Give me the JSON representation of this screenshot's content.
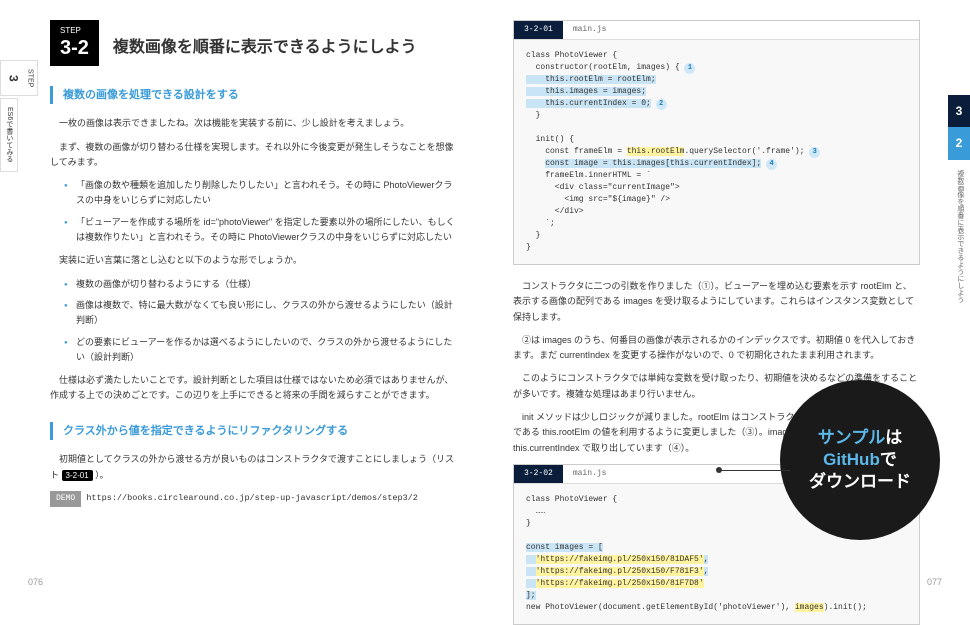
{
  "left": {
    "sidetab": {
      "step": "STEP",
      "num": "3",
      "label": "ES6で書いてみる"
    },
    "badge": {
      "step": "STEP",
      "num": "3-2"
    },
    "title": "複数画像を順番に表示できるようにしよう",
    "section1": {
      "heading": "複数の画像を処理できる設計をする",
      "p1": "一枚の画像は表示できましたね。次は機能を実装する前に、少し設計を考えましょう。",
      "p2": "まず、複数の画像が切り替わる仕様を実現します。それ以外に今後変更が発生しそうなことを想像してみます。",
      "bullets1": [
        "「画像の数や種類を追加したり削除したりしたい」と言われそう。その時に PhotoViewerクラスの中身をいじらずに対応したい",
        "「ビューアーを作成する場所を id=\"photoViewer\" を指定した要素以外の場所にしたい、もしくは複数作りたい」と言われそう。その時に PhotoViewerクラスの中身をいじらずに対応したい"
      ],
      "p3": "実装に近い言葉に落とし込むと以下のような形でしょうか。",
      "bullets2": [
        "複数の画像が切り替わるようにする（仕様）",
        "画像は複数で、特に最大数がなくても良い形にし、クラスの外から渡せるようにしたい（設計判断）",
        "どの要素にビューアーを作るかは選べるようにしたいので、クラスの外から渡せるようにしたい（設計判断）"
      ],
      "p4": "仕様は必ず満たしたいことです。設計判断とした項目は仕様ではないため必須ではありませんが、作成する上での決めごとです。この辺りを上手にできると将来の手間を減らすことができます。"
    },
    "section2": {
      "heading": "クラス外から値を指定できるようにリファクタリングする",
      "p1_a": "初期値としてクラスの外から渡せる方が良いものはコンストラクタで渡すことにしましょう（リスト",
      "p1_ref": "3-2-01",
      "p1_b": "）。",
      "demo_label": "DEMO",
      "demo_url": "https://books.circlearound.co.jp/step-up-javascript/demos/step3/2"
    },
    "pagenum": "076"
  },
  "right": {
    "sidetab": {
      "n3": "3",
      "n2": "2",
      "label": "複数画像を順番に表示できるようにしよう"
    },
    "code1": {
      "ref": "3-2-01",
      "file": "main.js",
      "lines": [
        "class PhotoViewer {",
        "  constructor(rootElm, images) { ①",
        "    this.rootElm = rootElm;",
        "    this.images = images;",
        "    this.currentIndex = 0; ②",
        "  }",
        "",
        "  init() {",
        "    const frameElm = this.rootElm.querySelector('.frame'); ③",
        "    const image = this.images[this.currentIndex]; ④",
        "    frameElm.innerHTML = `",
        "      <div class=\"currentImage\">",
        "        <img src=\"${image}\" />",
        "      </div>",
        "    `;",
        "  }",
        "}"
      ]
    },
    "para": {
      "p1": "コンストラクタに二つの引数を作りました（①）。ビューアーを埋め込む要素を示す rootElm と、表示する画像の配列である images を受け取るようにしています。これらはインスタンス変数として保持します。",
      "p2": "②は images のうち、何番目の画像が表示されるかのインデックスです。初期値 0 を代入しておきます。まだ currentIndex を変更する操作がないので、0 で初期化されたまま利用されます。",
      "p3": "このようにコンストラクタでは単純な変数を受け取ったり、初期値を決めるなどの準備をすることが多いです。複雑な処理はあまり行いません。",
      "p4": "init メソッドは少しロジックが減りました。rootElm はコンストラクタで保持したインスタンス変数である this.rootElm の値を利用するように変更しました（③）。image も同様に this.images から、this.currentIndex で取り出しています（④）。"
    },
    "code2": {
      "ref": "3-2-02",
      "file": "main.js",
      "lines": [
        "class PhotoViewer {",
        "  ……",
        "}",
        "",
        "const images = [",
        "  'https://fakeimg.pl/250x150/81DAF5',",
        "  'https://fakeimg.pl/250x150/F781F3',",
        "  'https://fakeimg.pl/250x150/81F7D8'",
        "];",
        "new PhotoViewer(document.getElementById('photoViewer'), images).init();"
      ]
    },
    "badge": {
      "l1a": "サンプル",
      "l1b": "は",
      "l2a": "GitHub",
      "l2b": "で",
      "l3": "ダウンロード"
    },
    "pagenum": "077"
  }
}
